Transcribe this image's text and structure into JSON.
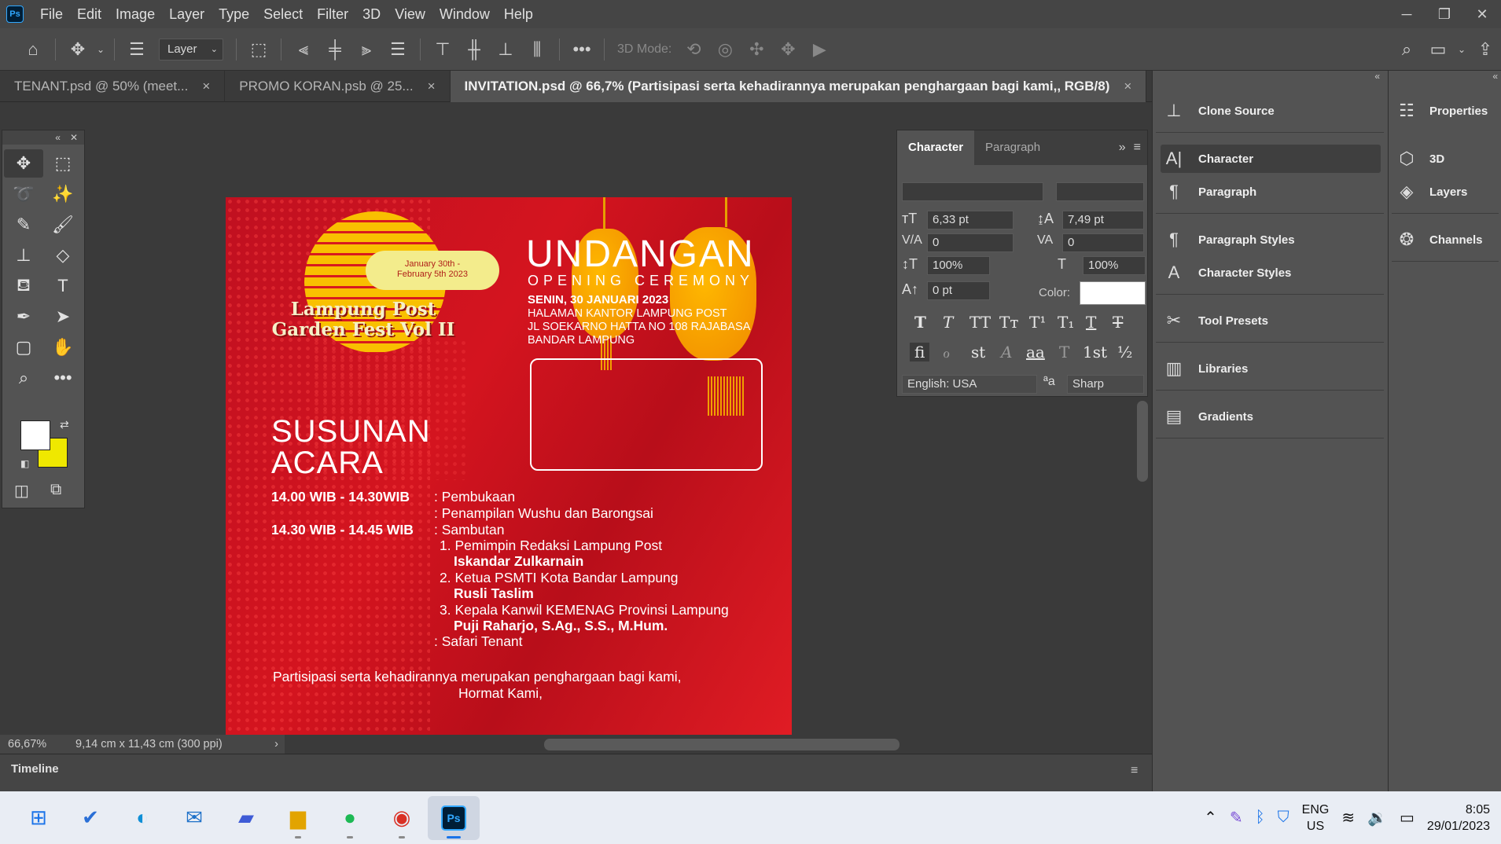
{
  "menu": [
    "File",
    "Edit",
    "Image",
    "Layer",
    "Type",
    "Select",
    "Filter",
    "3D",
    "View",
    "Window",
    "Help"
  ],
  "app_badge": "Ps",
  "optbar": {
    "layer_select": "Layer",
    "mode_3d": "3D Mode:"
  },
  "tabs": [
    {
      "label": "TENANT.psd @ 50% (meet...",
      "close": "×"
    },
    {
      "label": "PROMO KORAN.psb @ 25...",
      "close": "×"
    },
    {
      "label": "INVITATION.psd @ 66,7% (Partisipasi serta kehadirannya merupakan penghargaan bagi kami,, RGB/8)",
      "close": "×"
    }
  ],
  "canvas": {
    "cloud_line1": "January 30th -",
    "cloud_line2": "February 5th 2023",
    "fest_line1": "Lampung Post",
    "fest_line2": "Garden Fest Vol II",
    "undangan": "UNDANGAN",
    "opening": "OPENING CEREMONY",
    "date": "SENIN, 30 JANUARI 2023",
    "venue1": "HALAMAN KANTOR LAMPUNG POST",
    "venue2": "JL SOEKARNO HATTA NO 108 RAJABASA",
    "venue3": "BANDAR LAMPUNG",
    "susunan1": "SUSUNAN",
    "susunan2": "ACARA",
    "time1": "14.00 WIB - 14.30WIB",
    "time2": "14.30 WIB - 14.45 WIB",
    "items": [
      ": Pembukaan",
      ": Penampilan Wushu dan Barongsai",
      ": Sambutan"
    ],
    "speeches": [
      {
        "role": "1. Pemimpin Redaksi Lampung Post",
        "name": "Iskandar Zulkarnain"
      },
      {
        "role": "2. Ketua PSMTI Kota Bandar Lampung",
        "name": "Rusli Taslim"
      },
      {
        "role": "3. Kepala Kanwil KEMENAG Provinsi Lampung",
        "name": "Puji Raharjo, S.Ag., S.S., M.Hum."
      }
    ],
    "last_item": ": Safari Tenant",
    "closing1": "Partisipasi serta kehadirannya merupakan penghargaan bagi kami,",
    "closing2": "Hormat Kami,"
  },
  "status": {
    "zoom": "66,67%",
    "doc": "9,14 cm x 11,43 cm (300 ppi)"
  },
  "timeline": "Timeline",
  "character_panel": {
    "tab_character": "Character",
    "tab_paragraph": "Paragraph",
    "size": "6,33 pt",
    "leading": "7,49 pt",
    "kerning": "0",
    "tracking": "0",
    "vscale": "100%",
    "hscale": "100%",
    "baseline": "0 pt",
    "color_label": "Color:",
    "language": "English: USA",
    "antialias": "Sharp",
    "antialias_icon": "ªa",
    "type_buttons": [
      "T",
      "T",
      "TT",
      "Tт",
      "T¹",
      "T₁",
      "T",
      "T"
    ],
    "opentype_buttons": [
      "fi",
      "ℴ",
      "st",
      "A",
      "aa",
      "T",
      "1st",
      "½"
    ],
    "text_color": "#ffffff"
  },
  "dock1": [
    "Clone Source",
    "Character",
    "Paragraph",
    "Paragraph Styles",
    "Character Styles",
    "Tool Presets",
    "Libraries",
    "Gradients"
  ],
  "dock2": [
    "Properties",
    "3D",
    "Layers",
    "Channels"
  ],
  "tray": {
    "lang1": "ENG",
    "lang2": "US",
    "time": "8:05",
    "date": "29/01/2023"
  },
  "colors": {
    "foreground": "#ffffff",
    "background": "#efe800",
    "accent": "#31a8ff"
  }
}
